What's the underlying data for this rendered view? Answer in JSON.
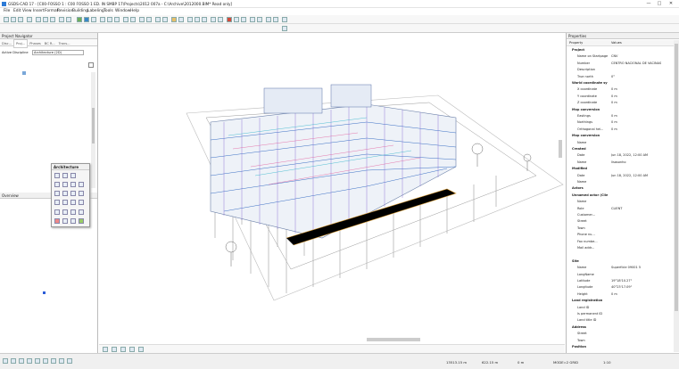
{
  "window": {
    "title": "GSDS-CAD 17 - [C00-FOSSO 1 : C00 FOSSO 1  ED. IN SMBP 17\\Projects\\2012 007a - C:\\Archive\\2012000.BIM* Read only]",
    "controls": [
      "—",
      "□",
      "✕"
    ]
  },
  "menu": [
    "File",
    "Edit",
    "View",
    "Insert",
    "Format",
    "Revision",
    "Building",
    "Labeling",
    "Tools",
    "Window",
    "Help"
  ],
  "project_navigator": {
    "title": "Project Navigator",
    "tabs": [
      "Disc...",
      "Proj...",
      "Phases",
      "BC R...",
      "Trans..."
    ],
    "active_discipline_label": "Active Discipline",
    "active_discipline_value": "Architecture (2D)"
  },
  "overview": {
    "title": "Overview"
  },
  "architecture_palette": {
    "title": "Architecture"
  },
  "properties": {
    "title": "Properties",
    "columns": [
      "Property",
      "Values"
    ],
    "rows": [
      {
        "k": "Project",
        "v": "",
        "sec": true
      },
      {
        "k": "Name on Startpage",
        "v": "CNV"
      },
      {
        "k": "Number",
        "v": "CENTRO NACIONAL DE VACINAS"
      },
      {
        "k": "Description",
        "v": ""
      },
      {
        "k": "True north",
        "v": "0°"
      },
      {
        "k": "World coordinate system",
        "v": "",
        "sec": true
      },
      {
        "k": "X coordinate",
        "v": "0 m"
      },
      {
        "k": "Y coordinate",
        "v": "0 m"
      },
      {
        "k": "Z coordinate",
        "v": "0 m"
      },
      {
        "k": "Map conversion",
        "v": "",
        "sec": true
      },
      {
        "k": "Eastings",
        "v": "0 m"
      },
      {
        "k": "Northings",
        "v": "0 m"
      },
      {
        "k": "Orthogonal hei...",
        "v": "0 m"
      },
      {
        "k": "Map conversion",
        "v": "",
        "sec": true
      },
      {
        "k": "Name",
        "v": ""
      },
      {
        "k": "Created",
        "v": "",
        "sec": true
      },
      {
        "k": "Date",
        "v": "Jun 18, 2022, 12:00 AM"
      },
      {
        "k": "Name",
        "v": "lisasonho"
      },
      {
        "k": "Modified",
        "v": "",
        "sec": true
      },
      {
        "k": "Date",
        "v": "Jun 18, 2022, 12:00 AM"
      },
      {
        "k": "Name",
        "v": ""
      },
      {
        "k": "Actors",
        "v": "",
        "sec": true
      },
      {
        "k": "Unnamed actor (Client)",
        "v": "",
        "sec": true
      },
      {
        "k": "Name",
        "v": ""
      },
      {
        "k": "Role",
        "v": "CLIENT"
      },
      {
        "k": "Customer...",
        "v": ""
      },
      {
        "k": "Street",
        "v": ""
      },
      {
        "k": "Town",
        "v": ""
      },
      {
        "k": "Phone nu...",
        "v": ""
      },
      {
        "k": "Fax numbe...",
        "v": ""
      },
      {
        "k": "Mail addr...",
        "v": ""
      },
      {
        "k": "",
        "v": ""
      },
      {
        "k": "Site",
        "v": "",
        "sec": true
      },
      {
        "k": "Name",
        "v": "Superfície 09001 5"
      },
      {
        "k": "LongName",
        "v": ""
      },
      {
        "k": "Latitude",
        "v": "19°18'10.27\""
      },
      {
        "k": "Longitude",
        "v": "40°23'17.09\""
      },
      {
        "k": "Height",
        "v": "0 m"
      },
      {
        "k": "Land registration",
        "v": "",
        "sec": true
      },
      {
        "k": "Land ID",
        "v": ""
      },
      {
        "k": "Is permanent ID",
        "v": ""
      },
      {
        "k": "Land title ID",
        "v": ""
      },
      {
        "k": "Address",
        "v": "",
        "sec": true
      },
      {
        "k": "Street",
        "v": ""
      },
      {
        "k": "Town",
        "v": ""
      },
      {
        "k": "Position",
        "v": "",
        "sec": true
      }
    ]
  },
  "status": {
    "x": "13513.15 m",
    "y": "622.15 m",
    "z": "0 m",
    "mode": "MODE=2 GRID",
    "scale": "1:10"
  }
}
